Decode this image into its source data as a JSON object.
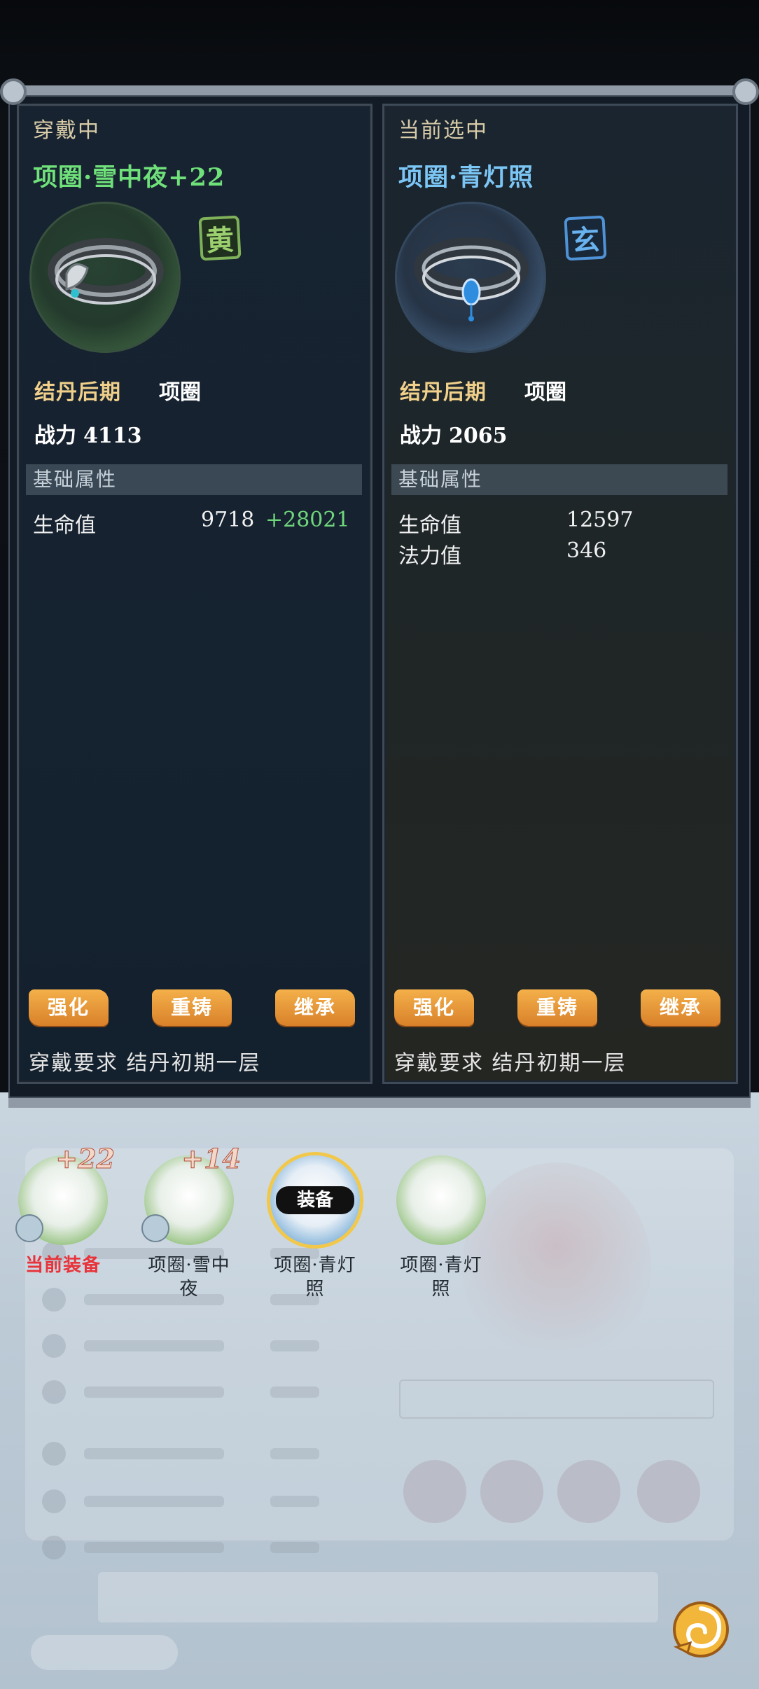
{
  "left_panel": {
    "header": "穿戴中",
    "item_name": "项圈·雪中夜+22",
    "grade_badge": "黄",
    "realm": "结丹后期",
    "type": "项圈",
    "power_label": "战力",
    "power_value": "4113",
    "attr_section": "基础属性",
    "stats": [
      {
        "label": "生命值",
        "value": "9718",
        "bonus": "+28021"
      }
    ],
    "buttons": [
      "强化",
      "重铸",
      "继承"
    ],
    "requirement": "穿戴要求  结丹初期一层"
  },
  "right_panel": {
    "header": "当前选中",
    "item_name": "项圈·青灯照",
    "grade_badge": "玄",
    "realm": "结丹后期",
    "type": "项圈",
    "power_label": "战力",
    "power_value": "2065",
    "attr_section": "基础属性",
    "stats": [
      {
        "label": "生命值",
        "value": "12597"
      },
      {
        "label": "法力值",
        "value": "346"
      }
    ],
    "buttons": [
      "强化",
      "重铸",
      "继承"
    ],
    "requirement": "穿戴要求  结丹初期一层"
  },
  "selector": {
    "items": [
      {
        "plus": "+22",
        "label_line1": "当前装备",
        "label_line2": ""
      },
      {
        "plus": "+14",
        "label_line1": "项圈·雪中",
        "label_line2": "夜"
      },
      {
        "tag": "装备",
        "label_line1": "项圈·青灯",
        "label_line2": "照"
      },
      {
        "label_line1": "项圈·青灯",
        "label_line2": "照"
      }
    ]
  },
  "colors": {
    "equipped_name": "#6fe07a",
    "selected_name": "#7cc6f5",
    "bonus_green": "#6fd77b",
    "current_red": "#e8333a",
    "button_orange": "#e89536"
  }
}
